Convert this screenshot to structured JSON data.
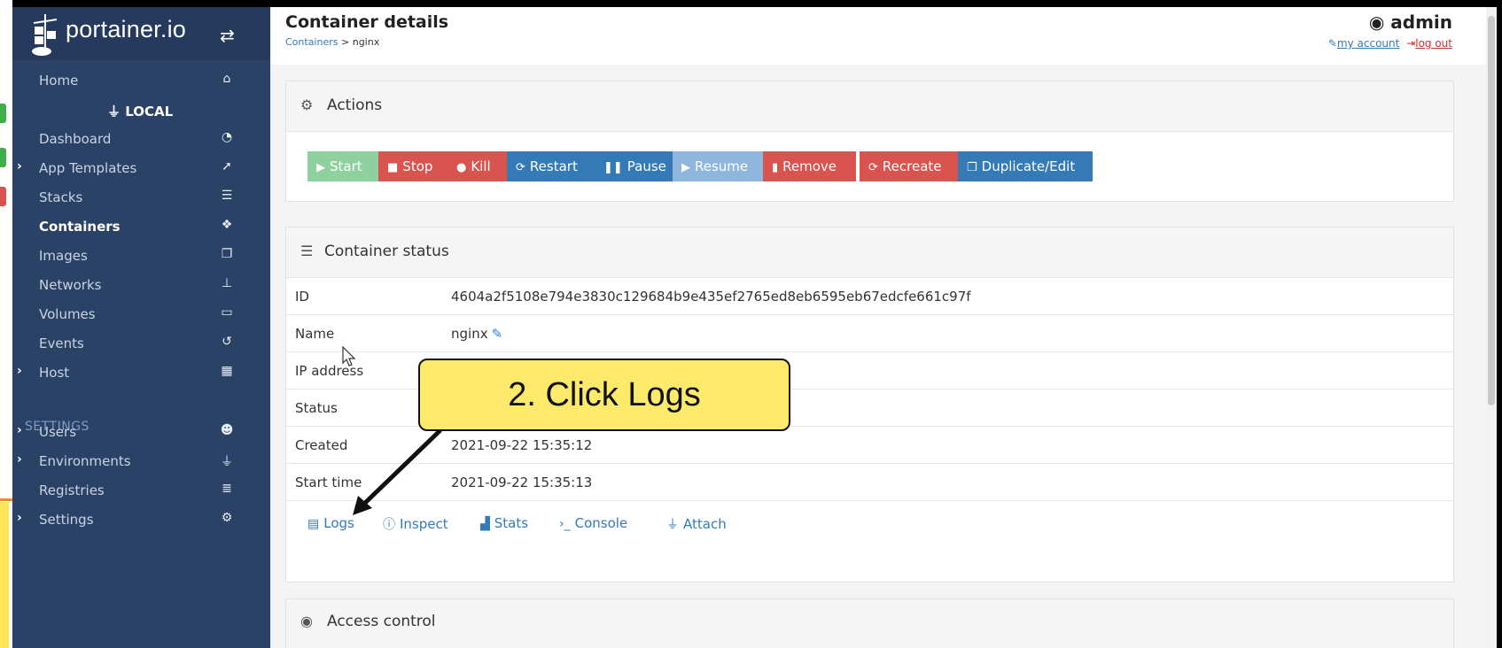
{
  "brand": {
    "name": "portainer.io"
  },
  "sidebar": {
    "items": [
      {
        "label": "Home",
        "icon": "home-icon",
        "glyph": "⌂"
      },
      {
        "label": "LOCAL",
        "icon": "plug-icon",
        "glyph": "⏚"
      },
      {
        "label": "Dashboard",
        "icon": "dashboard-icon",
        "glyph": "◔"
      },
      {
        "label": "App Templates",
        "icon": "rocket-icon",
        "glyph": "➚"
      },
      {
        "label": "Stacks",
        "icon": "list-icon",
        "glyph": "☰"
      },
      {
        "label": "Containers",
        "icon": "cubes-icon",
        "glyph": "❖"
      },
      {
        "label": "Images",
        "icon": "clone-icon",
        "glyph": "❐"
      },
      {
        "label": "Networks",
        "icon": "sitemap-icon",
        "glyph": "⊥"
      },
      {
        "label": "Volumes",
        "icon": "hdd-icon",
        "glyph": "▭"
      },
      {
        "label": "Events",
        "icon": "history-icon",
        "glyph": "↺"
      },
      {
        "label": "Host",
        "icon": "th-icon",
        "glyph": "▦"
      },
      {
        "label": "Users",
        "icon": "users-icon",
        "glyph": "☻"
      },
      {
        "label": "Environments",
        "icon": "plug-icon",
        "glyph": "⏚"
      },
      {
        "label": "Registries",
        "icon": "database-icon",
        "glyph": "≣"
      },
      {
        "label": "Settings",
        "icon": "cogs-icon",
        "glyph": "⚙"
      }
    ],
    "settings_heading": "SETTINGS"
  },
  "header": {
    "title": "Container details",
    "breadcrumb_link": "Containers",
    "breadcrumb_sep": " > ",
    "breadcrumb_current": "nginx",
    "user": "admin",
    "my_account": "my account",
    "log_out": "log out"
  },
  "actions": {
    "title": "Actions",
    "buttons": [
      {
        "label": "Start",
        "icon": "play-icon",
        "glyph": "▶",
        "color": "#8fd19e"
      },
      {
        "label": "Stop",
        "icon": "stop-icon",
        "glyph": "■",
        "color": "#d9534f"
      },
      {
        "label": "Kill",
        "icon": "bomb-icon",
        "glyph": "●",
        "color": "#d9534f"
      },
      {
        "label": "Restart",
        "icon": "refresh-icon",
        "glyph": "⟳",
        "color": "#337ab7"
      },
      {
        "label": "Pause",
        "icon": "pause-icon",
        "glyph": "❚❚",
        "color": "#337ab7"
      },
      {
        "label": "Resume",
        "icon": "play-icon",
        "glyph": "▶",
        "color": "#8fb6dc"
      },
      {
        "label": "Remove",
        "icon": "trash-icon",
        "glyph": "▮",
        "color": "#d9534f"
      },
      {
        "label": "Recreate",
        "icon": "refresh-icon",
        "glyph": "⟳",
        "color": "#d9534f"
      },
      {
        "label": "Duplicate/Edit",
        "icon": "copy-icon",
        "glyph": "❐",
        "color": "#337ab7"
      }
    ]
  },
  "status": {
    "title": "Container status",
    "rows": [
      {
        "key": "ID",
        "value": "4604a2f5108e794e3830c129684b9e435ef2765ed8eb6595eb67edcfe661c97f"
      },
      {
        "key": "Name",
        "value": "nginx"
      },
      {
        "key": "IP address",
        "value": ""
      },
      {
        "key": "Status",
        "value": ""
      },
      {
        "key": "Created",
        "value": "2021-09-22 15:35:12"
      },
      {
        "key": "Start time",
        "value": "2021-09-22 15:35:13"
      }
    ],
    "links": [
      {
        "label": "Logs",
        "icon": "file-text-icon",
        "glyph": "▤"
      },
      {
        "label": "Inspect",
        "icon": "info-circle-icon",
        "glyph": "ⓘ"
      },
      {
        "label": "Stats",
        "icon": "area-chart-icon",
        "glyph": "▟"
      },
      {
        "label": "Console",
        "icon": "terminal-icon",
        "glyph": "›_"
      },
      {
        "label": "Attach",
        "icon": "plug-icon",
        "glyph": "⏚"
      }
    ]
  },
  "access_control": {
    "title": "Access control"
  },
  "annotation": {
    "text": "2. Click Logs"
  },
  "colors": {
    "sidebar": "#2b4267",
    "brand": "#253a5c",
    "link": "#337ab7",
    "callout": "#fde96a"
  }
}
